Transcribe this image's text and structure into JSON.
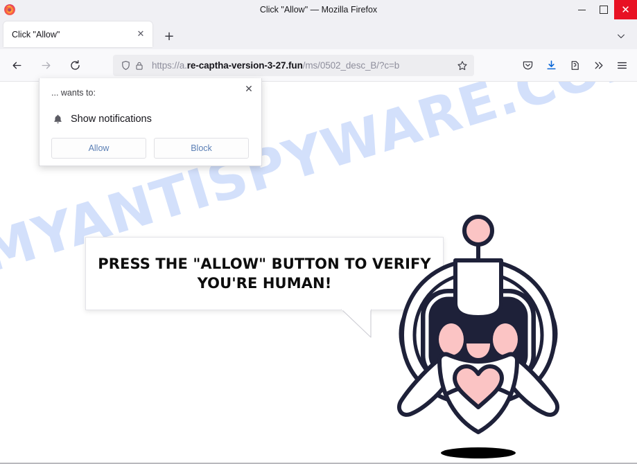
{
  "window": {
    "title": "Click \"Allow\" — Mozilla Firefox",
    "minimize_label": "–",
    "maximize_label": "□",
    "close_label": "✕",
    "app_icon": "firefox-logo"
  },
  "tabs": {
    "items": [
      {
        "title": "Click \"Allow\"",
        "close_label": "✕"
      }
    ],
    "new_tab_label": "+",
    "list_all_tabs_icon": "chevron-down-icon"
  },
  "toolbar": {
    "back_icon": "back-arrow-icon",
    "forward_icon": "forward-arrow-icon",
    "reload_icon": "reload-icon",
    "shield_icon": "shield-icon",
    "lock_icon": "padlock-icon",
    "bookmark_icon": "star-icon",
    "pocket_icon": "pocket-save-icon",
    "downloads_icon": "download-arrow-icon",
    "account_icon": "account-icon",
    "overflow_label": "»",
    "menu_label": "☰"
  },
  "urlbar": {
    "scheme": "https://a.",
    "host": "re-captha-version-3-27.fun",
    "path": "/ms/0502_desc_B/?c=b",
    "full_url": "https://a.re-captha-version-3-27.fun/ms/0502_desc_B/?c=b"
  },
  "permission_popup": {
    "origin_text": "... wants to:",
    "permission_label": "Show notifications",
    "permission_icon": "bell-icon",
    "allow_label": "Allow",
    "block_label": "Block",
    "close_label": "✕",
    "link_color": "#5b7fb5"
  },
  "page": {
    "bubble_text": "PRESS THE \"ALLOW\" BUTTON TO VERIFY YOU'RE HUMAN!",
    "watermark_text": "MYANTISPYWARE.COM",
    "watermark_color": "#d3e0fb",
    "robot": {
      "name": "robot-mascot",
      "outline_color": "#1e2139",
      "accent_color": "#fbc4c4",
      "screen_color": "#1e2139",
      "body_color": "#ffffff",
      "shadow_color": "#000000"
    }
  }
}
